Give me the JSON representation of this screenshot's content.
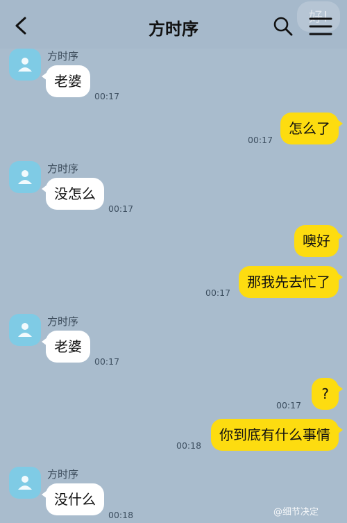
{
  "header": {
    "title": "方时序",
    "ghost_text": "好!"
  },
  "messages": [
    {
      "side": "left",
      "sender": "方时序",
      "text": "老婆",
      "time": "00:17"
    },
    {
      "side": "right",
      "text": "怎么了",
      "time": "00:17"
    },
    {
      "side": "left",
      "sender": "方时序",
      "text": "没怎么",
      "time": "00:17"
    },
    {
      "side": "right",
      "text": "噢好"
    },
    {
      "side": "right",
      "text": "那我先去忙了",
      "time": "00:17"
    },
    {
      "side": "left",
      "sender": "方时序",
      "text": "老婆",
      "time": "00:17"
    },
    {
      "side": "right",
      "text": "?",
      "time": "00:17"
    },
    {
      "side": "right",
      "text": "你到底有什么事情",
      "time": "00:18"
    },
    {
      "side": "left",
      "sender": "方时序",
      "text": "没什么",
      "time": "00:18"
    }
  ],
  "watermark": "@细节决定",
  "colors": {
    "background": "#a9bccd",
    "own_bubble": "#fddc10",
    "other_bubble": "#ffffff",
    "avatar": "#7fcbe5"
  },
  "icons": [
    "back-arrow-icon",
    "search-icon",
    "menu-icon",
    "person-icon"
  ]
}
